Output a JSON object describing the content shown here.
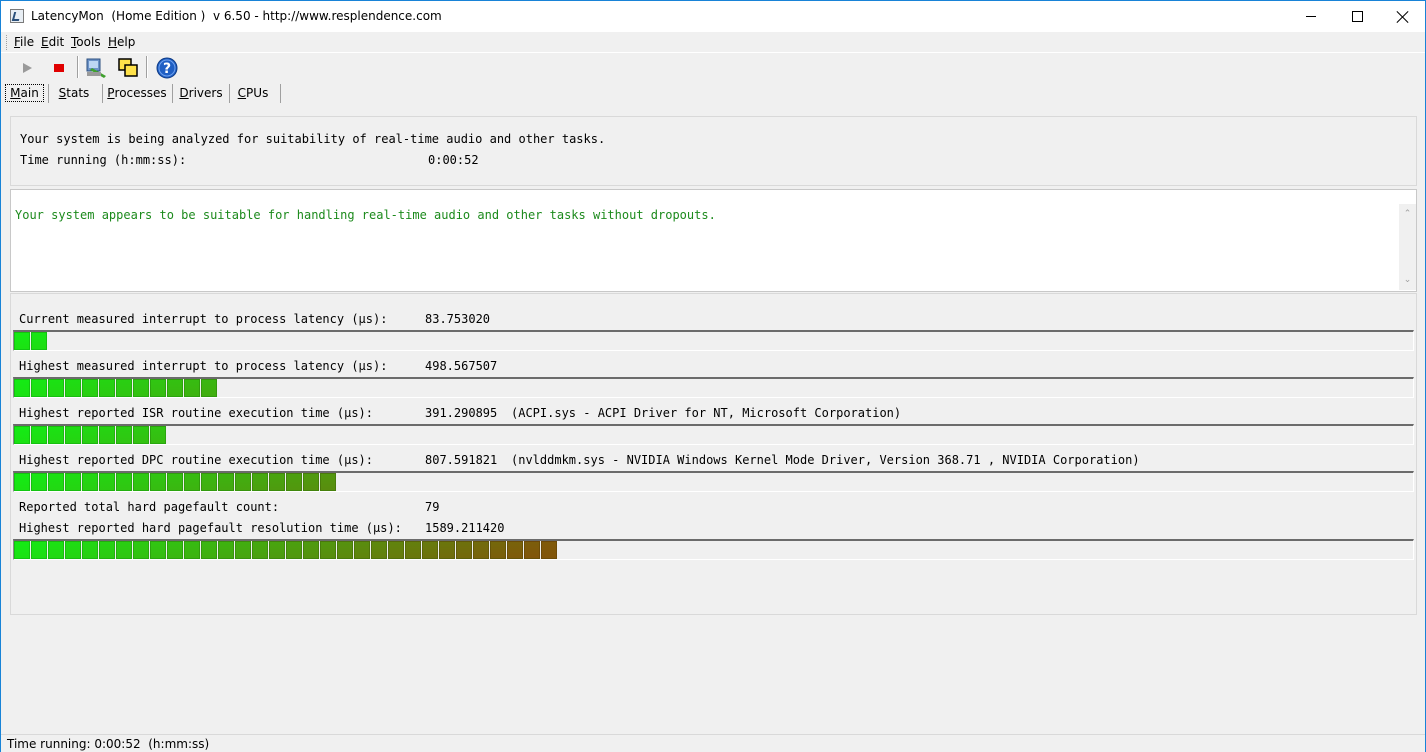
{
  "window": {
    "title": "LatencyMon  (Home Edition )  v 6.50 - http://www.resplendence.com"
  },
  "menu": {
    "items": [
      {
        "label": "File",
        "accel": "F",
        "rest": "ile"
      },
      {
        "label": "Edit",
        "accel": "E",
        "rest": "dit"
      },
      {
        "label": "Tools",
        "accel": "T",
        "rest": "ools"
      },
      {
        "label": "Help",
        "accel": "H",
        "rest": "elp"
      }
    ]
  },
  "toolbar": {
    "buttons": [
      "play-icon",
      "stop-icon",
      "settings-icon",
      "window-icon",
      "help-icon"
    ]
  },
  "tabs": {
    "items": [
      {
        "label": "Main",
        "accel": "M",
        "rest": "ain",
        "active": true
      },
      {
        "label": "Stats",
        "accel": "S",
        "rest": "tats",
        "active": false
      },
      {
        "label": "Processes",
        "accel": "P",
        "rest": "rocesses",
        "active": false
      },
      {
        "label": "Drivers",
        "accel": "D",
        "rest": "rivers",
        "active": false
      },
      {
        "label": "CPUs",
        "accel": "C",
        "rest": "PUs",
        "active": false
      }
    ]
  },
  "summary": {
    "line1": "Your system is being analyzed for suitability of real-time audio and other tasks.",
    "time_label": "Time running (h:mm:ss):",
    "time_value": "0:00:52"
  },
  "verdict": {
    "text": "Your system appears to be suitable for handling real-time audio and other tasks without dropouts.",
    "color": "#1c8a1c"
  },
  "metrics": [
    {
      "label": "Current measured interrupt to process latency (µs):",
      "value": "83.753020",
      "driver": "",
      "segments": 2
    },
    {
      "label": "Highest measured interrupt to process latency (µs):",
      "value": "498.567507",
      "driver": "",
      "segments": 12
    },
    {
      "label": "Highest reported ISR routine execution time (µs):",
      "value": "391.290895",
      "driver": "(ACPI.sys - ACPI Driver for NT, Microsoft Corporation)",
      "segments": 9
    },
    {
      "label": "Highest reported DPC routine execution time (µs):",
      "value": "807.591821",
      "driver": "(nvlddmkm.sys - NVIDIA Windows Kernel Mode Driver, Version 368.71 , NVIDIA Corporation)",
      "segments": 19
    }
  ],
  "pagefault": {
    "count_label": "Reported total hard pagefault count:",
    "count_value": "79",
    "time_label": "Highest reported hard pagefault resolution time (µs):",
    "time_value": "1589.211420",
    "segments": 32
  },
  "status": {
    "text": "Time running: 0:00:52  (h:mm:ss)"
  }
}
